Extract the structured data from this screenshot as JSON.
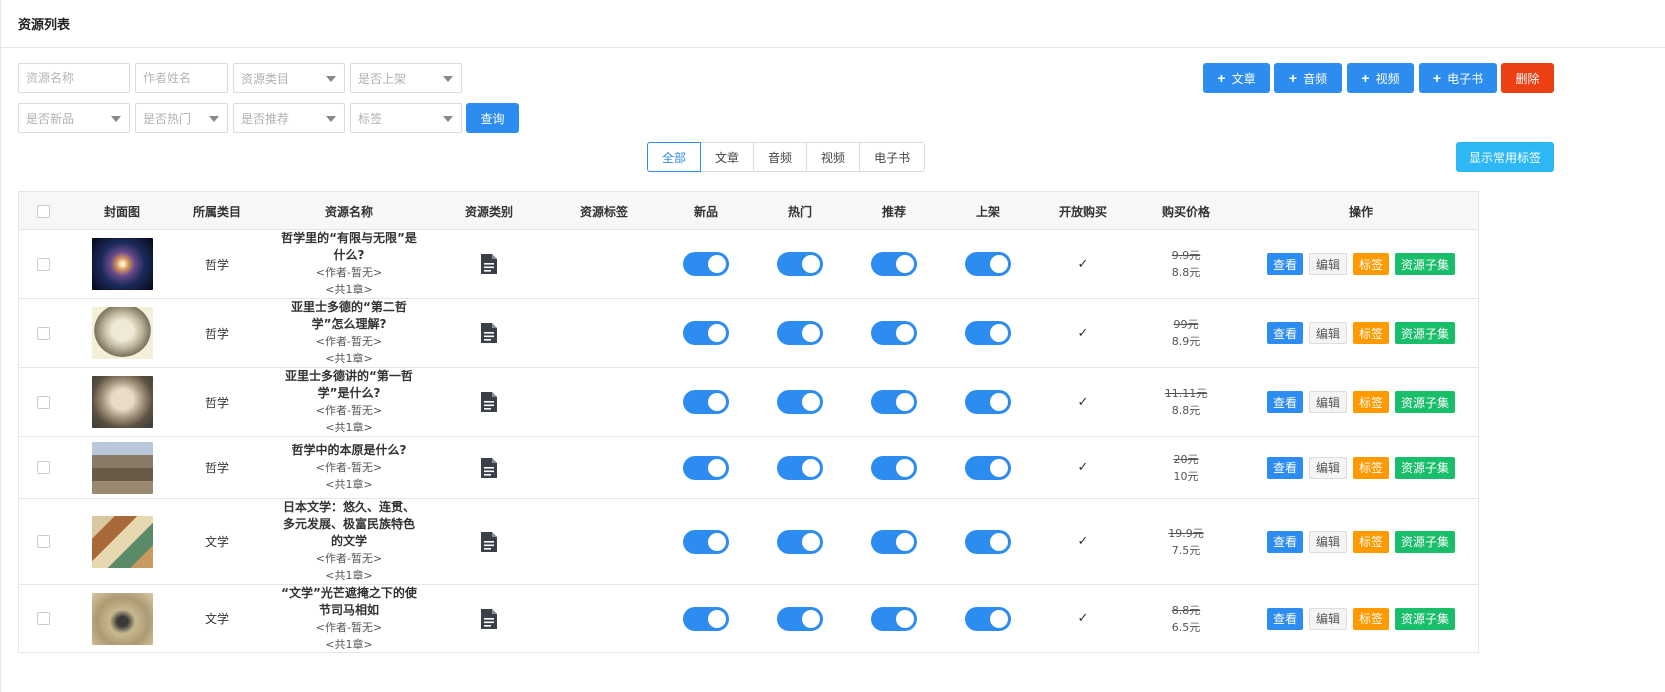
{
  "header": {
    "title": "资源列表"
  },
  "filters": {
    "resource_name": "资源名称",
    "author_name": "作者姓名",
    "category": "资源类目",
    "on_shelf": "是否上架",
    "is_new": "是否新品",
    "is_hot": "是否热门",
    "is_recommend": "是否推荐",
    "tag": "标签",
    "search_label": "查询"
  },
  "actions": {
    "article": "文章",
    "audio": "音频",
    "video": "视频",
    "ebook": "电子书",
    "delete": "删除",
    "show_tags": "显示常用标签"
  },
  "tabs": [
    "全部",
    "文章",
    "音频",
    "视频",
    "电子书"
  ],
  "active_tab": "全部",
  "columns": [
    "封面图",
    "所属类目",
    "资源名称",
    "资源类别",
    "资源标签",
    "新品",
    "热门",
    "推荐",
    "上架",
    "开放购买",
    "购买价格",
    "操作"
  ],
  "row_actions": {
    "view": "查看",
    "edit": "编辑",
    "tag": "标签",
    "subset": "资源子集"
  },
  "rows": [
    {
      "category": "哲学",
      "title": "哲学里的“有限与无限”是什么?",
      "author": "<作者-暂无>",
      "chapters": "<共1章>",
      "old_price": "9.9元",
      "price": "8.8元",
      "new": true,
      "hot": true,
      "recommend": true,
      "on_shelf": true,
      "open_buy": "✓"
    },
    {
      "category": "哲学",
      "title": "亚里士多德的“第二哲学”怎么理解?",
      "author": "<作者-暂无>",
      "chapters": "<共1章>",
      "old_price": "99元",
      "price": "8.9元",
      "new": true,
      "hot": true,
      "recommend": true,
      "on_shelf": true,
      "open_buy": "✓"
    },
    {
      "category": "哲学",
      "title": "亚里士多德讲的“第一哲学”是什么?",
      "author": "<作者-暂无>",
      "chapters": "<共1章>",
      "old_price": "11.11元",
      "price": "8.8元",
      "new": true,
      "hot": true,
      "recommend": true,
      "on_shelf": true,
      "open_buy": "✓"
    },
    {
      "category": "哲学",
      "title": "哲学中的本原是什么?",
      "author": "<作者-暂无>",
      "chapters": "<共1章>",
      "old_price": "20元",
      "price": "10元",
      "new": true,
      "hot": true,
      "recommend": true,
      "on_shelf": true,
      "open_buy": "✓"
    },
    {
      "category": "文学",
      "title": "日本文学：悠久、连贯、多元发展、极富民族特色的文学",
      "author": "<作者-暂无>",
      "chapters": "<共1章>",
      "old_price": "19.9元",
      "price": "7.5元",
      "new": true,
      "hot": true,
      "recommend": true,
      "on_shelf": true,
      "open_buy": "✓"
    },
    {
      "category": "文学",
      "title": "“文学”光芒遮掩之下的使节司马相如",
      "author": "<作者-暂无>",
      "chapters": "<共1章>",
      "old_price": "8.8元",
      "price": "6.5元",
      "new": true,
      "hot": true,
      "recommend": true,
      "on_shelf": true,
      "open_buy": "✓"
    }
  ]
}
